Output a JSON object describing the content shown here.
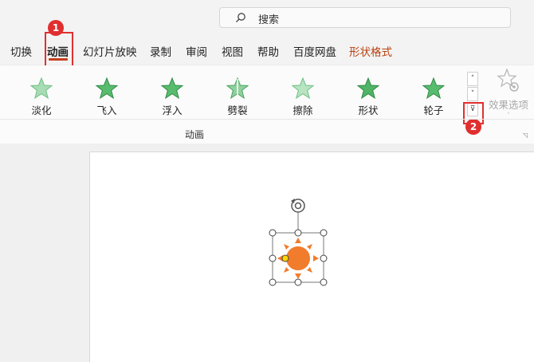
{
  "search": {
    "placeholder": "搜索"
  },
  "tabs": [
    {
      "label": "切换"
    },
    {
      "label": "动画"
    },
    {
      "label": "幻灯片放映"
    },
    {
      "label": "录制"
    },
    {
      "label": "审阅"
    },
    {
      "label": "视图"
    },
    {
      "label": "帮助"
    },
    {
      "label": "百度网盘"
    },
    {
      "label": "形状格式"
    }
  ],
  "gallery": {
    "items": [
      {
        "label": "淡化"
      },
      {
        "label": "飞入"
      },
      {
        "label": "浮入"
      },
      {
        "label": "劈裂"
      },
      {
        "label": "擦除"
      },
      {
        "label": "形状"
      },
      {
        "label": "轮子"
      }
    ],
    "effect_options_label": "效果选项",
    "group_label": "动画"
  },
  "callouts": [
    {
      "number": "1"
    },
    {
      "number": "2"
    }
  ],
  "colors": {
    "accent": "#c43e1c",
    "callout": "#e02f2f",
    "sun": "#f07c2c",
    "star": "#3fae5a"
  }
}
